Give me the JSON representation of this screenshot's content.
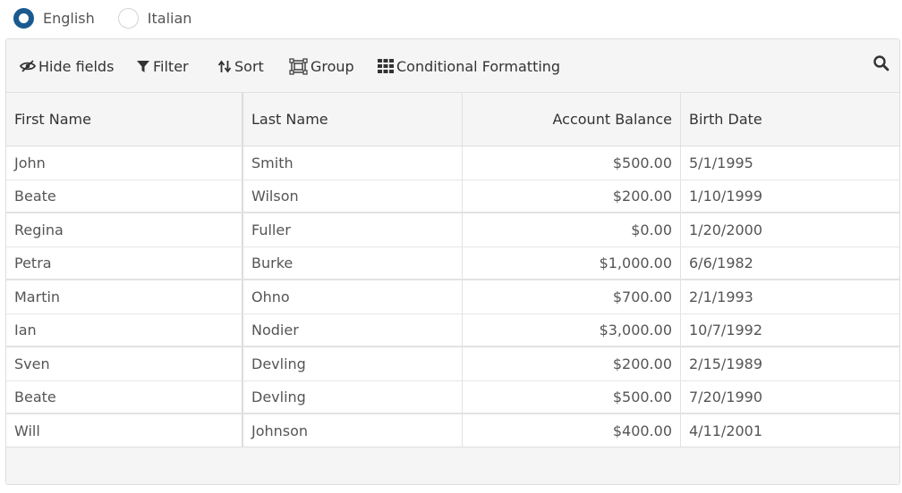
{
  "language": {
    "options": [
      {
        "label": "English",
        "checked": true
      },
      {
        "label": "Italian",
        "checked": false
      }
    ]
  },
  "toolbar": {
    "hide_fields": "Hide fields",
    "filter": "Filter",
    "sort": "Sort",
    "group": "Group",
    "conditional_formatting": "Conditional Formatting",
    "search_icon": "search-icon"
  },
  "columns": [
    "First Name",
    "Last Name",
    "Account Balance",
    "Birth Date"
  ],
  "rows": [
    [
      "John",
      "Smith",
      "$500.00",
      "5/1/1995"
    ],
    [
      "Beate",
      "Wilson",
      "$200.00",
      "1/10/1999"
    ],
    [
      "Regina",
      "Fuller",
      "$0.00",
      "1/20/2000"
    ],
    [
      "Petra",
      "Burke",
      "$1,000.00",
      "6/6/1982"
    ],
    [
      "Martin",
      "Ohno",
      "$700.00",
      "2/1/1993"
    ],
    [
      "Ian",
      "Nodier",
      "$3,000.00",
      "10/7/1992"
    ],
    [
      "Sven",
      "Devling",
      "$200.00",
      "2/15/1989"
    ],
    [
      "Beate",
      "Devling",
      "$500.00",
      "7/20/1990"
    ],
    [
      "Will",
      "Johnson",
      "$400.00",
      "4/11/2001"
    ]
  ],
  "colors": {
    "radio_checked": "#1a5a8e",
    "toolbar_bg": "#f5f5f5",
    "border": "#dddddd"
  }
}
